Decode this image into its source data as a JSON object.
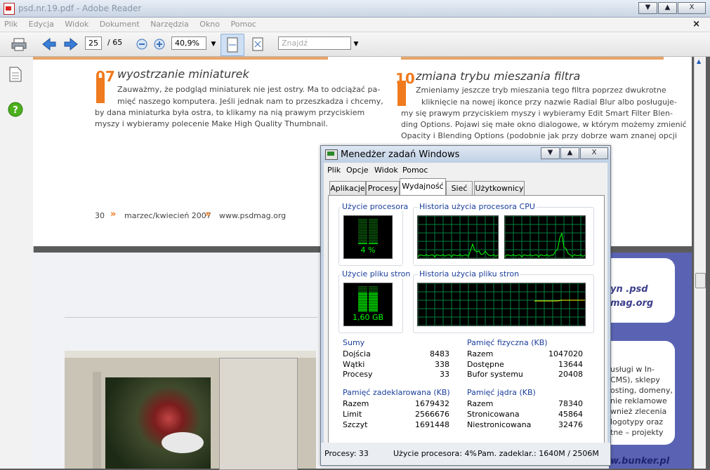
{
  "reader": {
    "title": "psd.nr.19.pdf - Adobe Reader",
    "menu": [
      "Plik",
      "Edycja",
      "Widok",
      "Dokument",
      "Narzędzia",
      "Okno",
      "Pomoc"
    ],
    "page_current": "25",
    "page_total": "/ 65",
    "zoom": "40,9%",
    "find_placeholder": "Znajdź",
    "window_buttons": [
      "▼",
      "▲",
      "X"
    ],
    "close_doc": "×"
  },
  "pdf": {
    "sec07": {
      "num": "07",
      "title": "wyostrzanie miniaturek",
      "lines": [
        "Zauważmy, że podgląd miniaturek nie jest ostry. Ma to odciążać pa-",
        "mięć naszego komputera. Jeśli jednak nam to przeszkadza i chcemy,",
        "by dana miniaturka była ostra, to klikamy na nią prawym przyciskiem",
        "myszy i wybieramy polecenie Make High Quality Thumbnail."
      ]
    },
    "sec10": {
      "num": "10",
      "title": "zmiana trybu mieszania filtra",
      "lines": [
        "Zmieniamy jeszcze tryb mieszania tego filtra poprzez dwukrotne",
        "kliknięcie na nowej ikonce przy nazwie Radial Blur albo posługuje-",
        "my się prawym przyciskiem myszy i wybieramy Edit Smart Filter Blen-",
        "ding Options. Pojawi się małe okno dialogowe, w którym możemy zmienić",
        "Opacity i Blending Options (podobnie jak przy dobrze wam znanej opcji"
      ]
    },
    "footer": {
      "page": "30",
      "sep": "»",
      "issue": "marzec/kwiecień 2007",
      "site": "www.psdmag.org"
    },
    "ad": {
      "l1": "yn .psd",
      "l2": "mag.org",
      "card": [
        "usługi w In-",
        "CMS), sklepy",
        "osting, domeny,",
        "nie reklamowe",
        "wnież zlecenia",
        "logotypy oraz",
        "tne – projekty"
      ],
      "bottom": "w.bunker.pl"
    }
  },
  "tm": {
    "title": "Menedżer zadań Windows",
    "window_buttons": [
      "▼",
      "▲",
      "X"
    ],
    "menu": [
      "Plik",
      "Opcje",
      "Widok",
      "Pomoc"
    ],
    "tabs": [
      "Aplikacje",
      "Procesy",
      "Wydajność",
      "Sieć",
      "Użytkownicy"
    ],
    "active_tab": "Wydajność",
    "cpu_label": "Użycie procesora",
    "cpu_value": "4 %",
    "cpu_hist_label": "Historia użycia procesora CPU",
    "pf_label": "Użycie pliku stron",
    "pf_value": "1,60 GB",
    "pf_hist_label": "Historia użycia pliku stron",
    "totals": {
      "title": "Sumy",
      "rows": [
        [
          "Dojścia",
          "8483"
        ],
        [
          "Wątki",
          "338"
        ],
        [
          "Procesy",
          "33"
        ]
      ]
    },
    "physical": {
      "title": "Pamięć fizyczna (KB)",
      "rows": [
        [
          "Razem",
          "1047020"
        ],
        [
          "Dostępne",
          "13644"
        ],
        [
          "Bufor systemu",
          "20408"
        ]
      ]
    },
    "commit": {
      "title": "Pamięć zadeklarowana (KB)",
      "rows": [
        [
          "Razem",
          "1679432"
        ],
        [
          "Limit",
          "2566676"
        ],
        [
          "Szczyt",
          "1691448"
        ]
      ]
    },
    "kernel": {
      "title": "Pamięć jądra (KB)",
      "rows": [
        [
          "Razem",
          "78340"
        ],
        [
          "Stronicowana",
          "45864"
        ],
        [
          "Niestronicowana",
          "32476"
        ]
      ]
    },
    "status": {
      "procs": "Procesy: 33",
      "cpu": "Użycie procesora: 4%",
      "mem": "Pam. zadeklar.: 1640M / 2506M"
    },
    "colors": {
      "meter": "#00ff00",
      "grid": "#008040",
      "commit_line": "#ffff00"
    }
  }
}
